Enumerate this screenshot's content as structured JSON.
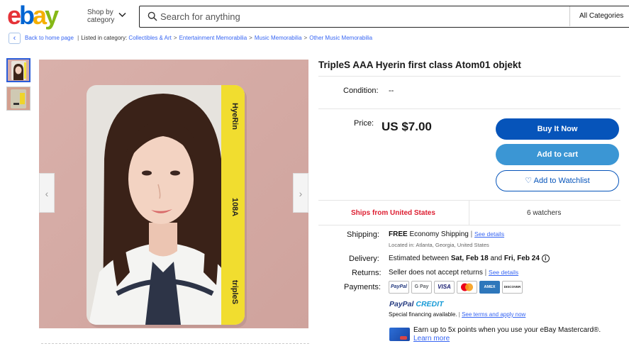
{
  "header": {
    "logo": [
      "e",
      "b",
      "a",
      "y"
    ],
    "shop_by": "Shop by",
    "category": "category",
    "search_placeholder": "Search for anything",
    "all_categories": "All Categories"
  },
  "breadcrumb": {
    "back": "Back to home page",
    "listed_in": "Listed in category:",
    "items": [
      "Collectibles & Art",
      "Entertainment Memorabilia",
      "Music Memorabilia",
      "Other Music Memorabilia"
    ]
  },
  "product": {
    "title": "TripleS AAA Hyerin first class Atom01 objekt",
    "condition_label": "Condition:",
    "condition_value": "--",
    "price_label": "Price:",
    "price": "US $7.00",
    "buy_now": "Buy It Now",
    "add_to_cart": "Add to cart",
    "watchlist": "Add to Watchlist",
    "ships_from": "Ships from United States",
    "watchers": "6 watchers"
  },
  "card": {
    "name": "HyeRin",
    "number": "108A",
    "brand": "tripleS"
  },
  "details": {
    "shipping_label": "Shipping:",
    "shipping_free": "FREE",
    "shipping_method": "Economy Shipping",
    "see_details": "See details",
    "location": "Located in: Atlanta, Georgia, United States",
    "delivery_label": "Delivery:",
    "delivery_prefix": "Estimated between",
    "delivery_start": "Sat, Feb 18",
    "delivery_and": "and",
    "delivery_end": "Fri, Feb 24",
    "returns_label": "Returns:",
    "returns_value": "Seller does not accept returns",
    "payments_label": "Payments:",
    "payment_methods": [
      "PayPal",
      "G Pay",
      "VISA",
      "MC",
      "AMEX",
      "DISCOVER"
    ],
    "paypal_credit_1": "PayPal",
    "paypal_credit_2": "CREDIT",
    "financing": "Special financing available.",
    "financing_link": "See terms and apply now",
    "mastercard_text": "Earn up to 5x points when you use your eBay Mastercard®.",
    "learn_more": "Learn more"
  },
  "colors": {
    "buy_now": "#0654ba",
    "add_to_cart": "#3b96d4",
    "ships": "#dd1e31",
    "link": "#3665f3"
  }
}
